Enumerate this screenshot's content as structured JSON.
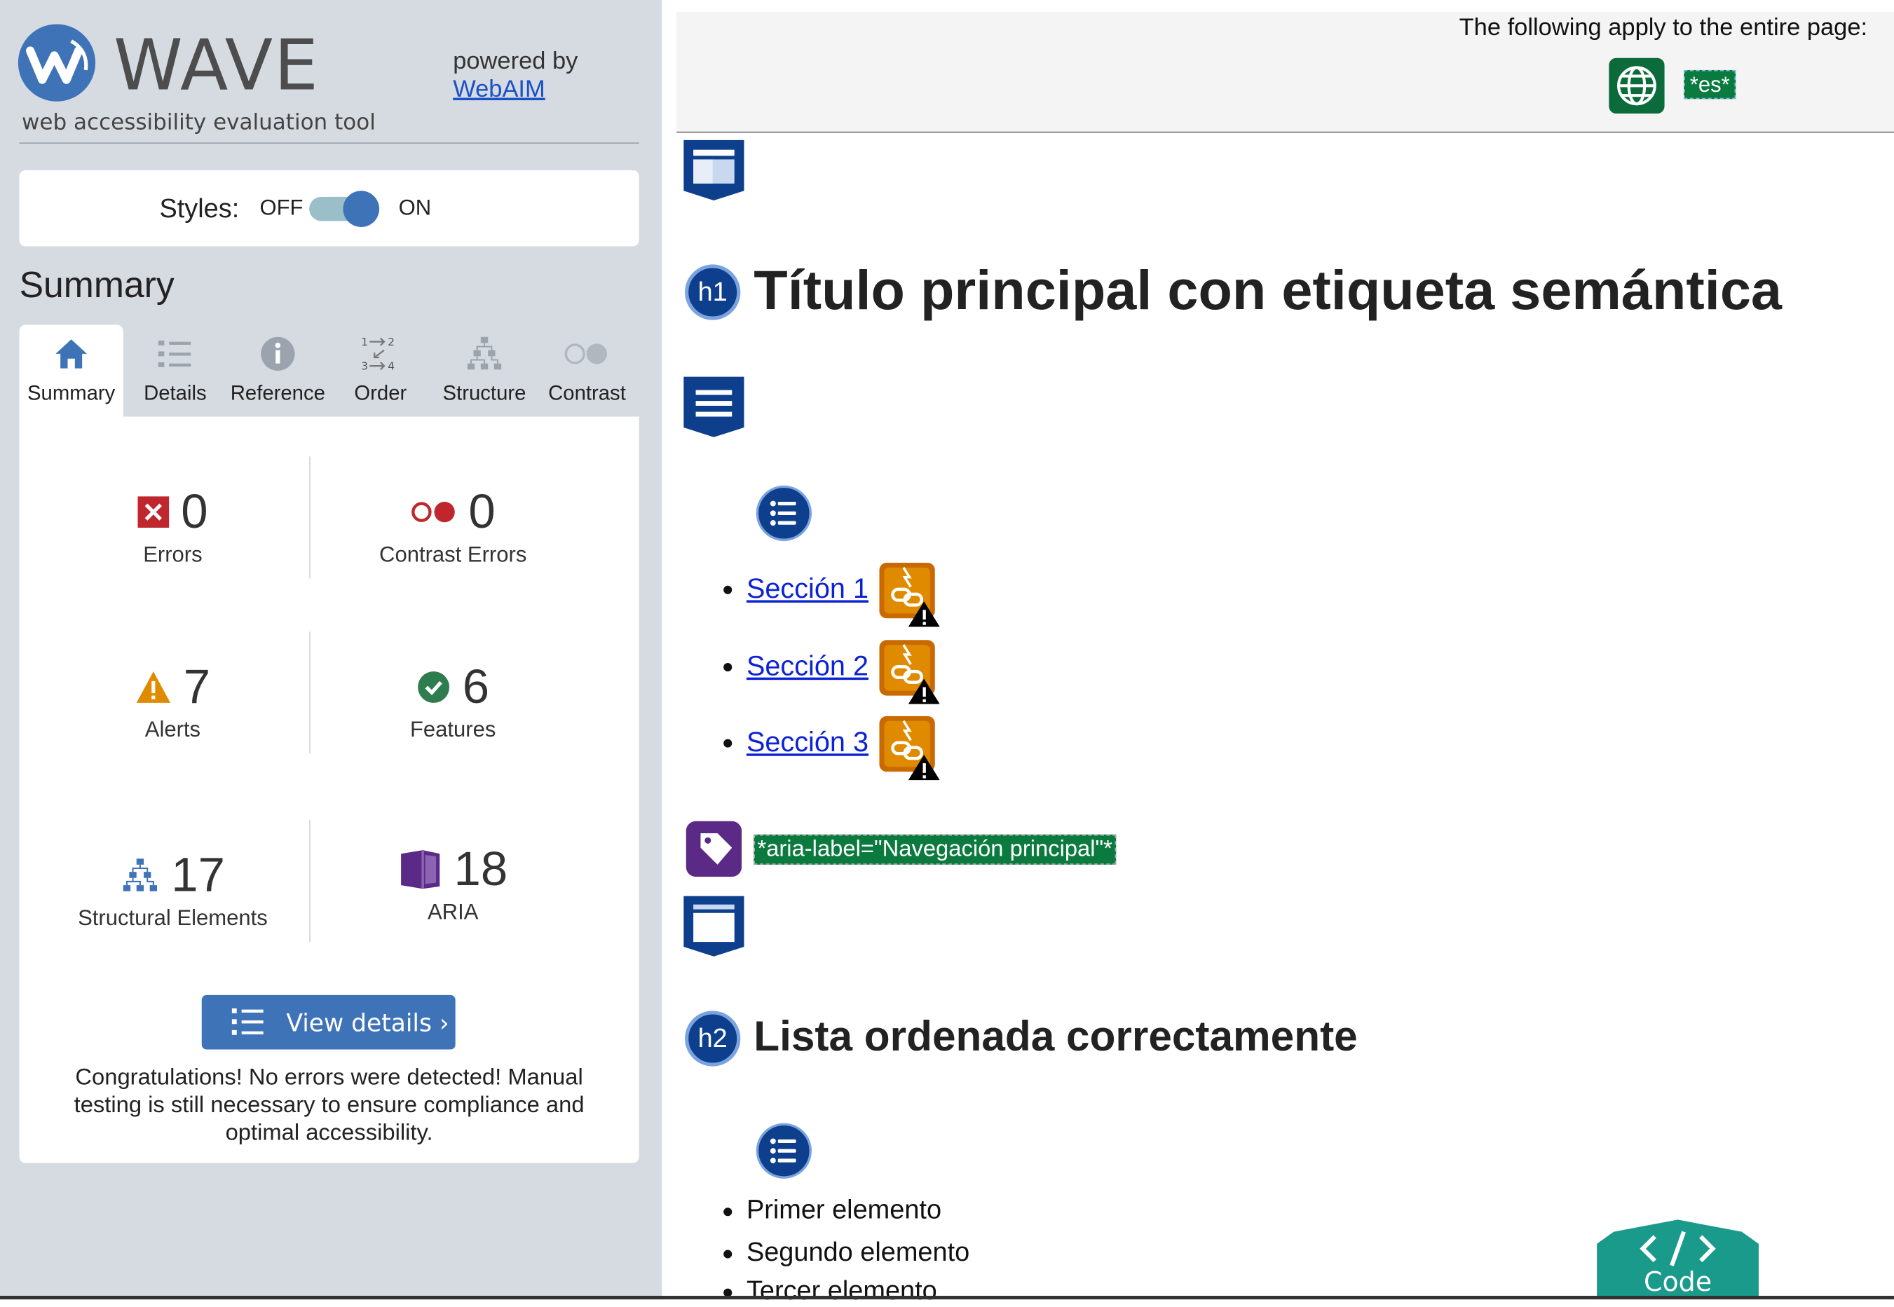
{
  "app": {
    "name": "WAVE",
    "tagline": "web accessibility evaluation tool",
    "powered_by": "powered by",
    "powered_link": "WebAIM"
  },
  "styles_toggle": {
    "label": "Styles:",
    "off": "OFF",
    "on": "ON",
    "state": "on"
  },
  "summary": {
    "heading": "Summary"
  },
  "tabs": [
    {
      "label": "Summary",
      "icon": "home-icon",
      "active": true
    },
    {
      "label": "Details",
      "icon": "list-icon"
    },
    {
      "label": "Reference",
      "icon": "info-icon"
    },
    {
      "label": "Order",
      "icon": "order-icon"
    },
    {
      "label": "Structure",
      "icon": "structure-icon"
    },
    {
      "label": "Contrast",
      "icon": "contrast-icon"
    }
  ],
  "stats": {
    "errors": {
      "value": "0",
      "label": "Errors",
      "color": "#c0262d"
    },
    "contrast": {
      "value": "0",
      "label": "Contrast Errors",
      "color": "#c0262d"
    },
    "alerts": {
      "value": "7",
      "label": "Alerts",
      "color": "#e08a00"
    },
    "features": {
      "value": "6",
      "label": "Features",
      "color": "#2e7d4f"
    },
    "structural": {
      "value": "17",
      "label": "Structural Elements",
      "color": "#3f73b7"
    },
    "aria": {
      "value": "18",
      "label": "ARIA",
      "color": "#5b2a86"
    }
  },
  "view_details": "View details ›",
  "congrats": "Congratulations! No errors were detected! Manual testing is still necessary to ensure compliance and optimal accessibility.",
  "page": {
    "applies_text": "The following apply to the entire page:",
    "lang_tag": "*es*",
    "h1_badge": "h1",
    "h1": "Título principal con etiqueta semántica",
    "links": [
      "Sección 1",
      "Sección 2",
      "Sección 3"
    ],
    "aria_label": "*aria-label=\"Navegación principal\"*",
    "h2_badge": "h2",
    "h2": "Lista ordenada correctamente",
    "list_items": [
      "Primer elemento",
      "Segundo elemento",
      "Tercer elemento"
    ],
    "code_button": "Code"
  }
}
